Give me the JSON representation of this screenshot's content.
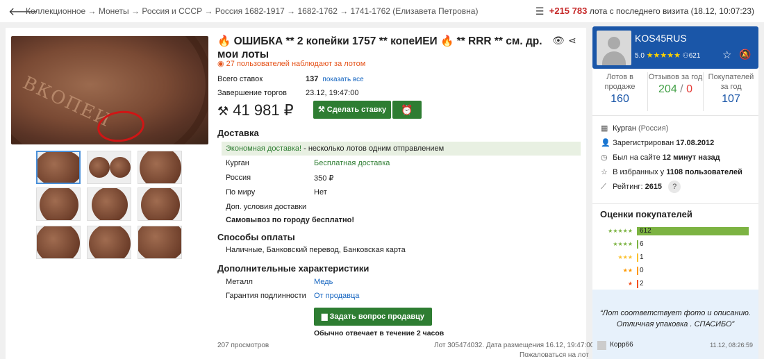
{
  "breadcrumbs": "Коллекционное → Монеты → Россия и СССР → Россия 1682-1917 → 1682-1762 → 1741-1762 (Елизавета Петровна)",
  "visit": {
    "count": "+215 783",
    "text": "лота с последнего визита (18.12, 10:07:23)"
  },
  "lot": {
    "title": "ОШИБКА ** 2 копейки 1757 ** копеИЕИ",
    "title_tail": "** RRR ** см. др. мои лоты",
    "watchers": "27 пользователей наблюдают за лотом",
    "bids_label": "Всего ставок",
    "bids_value": "137",
    "bids_link": "показать все",
    "end_label": "Завершение торгов",
    "end_value": "23.12, 19:47:00",
    "price": "41 981 ₽",
    "bid_button": "Сделать ставку"
  },
  "delivery": {
    "heading": "Доставка",
    "econ_link": "Экономная доставка!",
    "econ_text": " - несколько лотов одним отправлением",
    "rows": [
      {
        "label": "Курган",
        "value": "Бесплатная доставка"
      },
      {
        "label": "Россия",
        "value": "350 ₽"
      },
      {
        "label": "По миру",
        "value": "Нет"
      },
      {
        "label": "Доп. условия доставки",
        "value": ""
      }
    ],
    "pickup": "Самовывоз по городу бесплатно!"
  },
  "payment": {
    "heading": "Способы оплаты",
    "methods": "Наличные, Банковский перевод, Банковская карта"
  },
  "extra": {
    "heading": "Дополнительные характеристики",
    "rows": [
      {
        "label": "Металл",
        "value": "Медь"
      },
      {
        "label": "Гарантия подлинности",
        "value": "От продавца"
      }
    ]
  },
  "ask": {
    "button": "Задать вопрос продавцу",
    "note": "Обычно отвечает в течение 2 часов"
  },
  "footer": {
    "views": "207 просмотров",
    "lot_info": "Лот 305474032. Дата размещения 16.12, 19:47:00",
    "complain": "Пожаловаться на лот"
  },
  "seller": {
    "name": "KOS45RUS",
    "rating_score": "5.0",
    "followers": "621",
    "stats": [
      {
        "label": "Лотов в продаже",
        "value": "160"
      },
      {
        "label": "Отзывов за год",
        "value_pos": "204",
        "slash": " / ",
        "value_neg": "0"
      },
      {
        "label": "Покупателей за год",
        "value": "107"
      }
    ],
    "city": "Курган",
    "country": "(Россия)",
    "registered_prefix": "Зарегистрирован",
    "registered_date": "17.08.2012",
    "last_seen_prefix": "Был на сайте",
    "last_seen_value": "12 минут назад",
    "favorites_prefix": "В избранных у",
    "favorites_value": "1108 пользователей",
    "rating_prefix": "Рейтинг:",
    "rating_value": "2615",
    "rating_help": "?"
  },
  "ratings": {
    "title": "Оценки покупателей",
    "rows": [
      {
        "stars": "★★★★★",
        "count": "612",
        "share": 1.0,
        "color": "#7cb342"
      },
      {
        "stars": "★★★★",
        "count": "6",
        "share": 0.01,
        "color": "#7cb342"
      },
      {
        "stars": "★★★",
        "count": "1",
        "share": 0.002,
        "color": "#fbc02d"
      },
      {
        "stars": "★★",
        "count": "0",
        "share": 0,
        "color": "#ff9800"
      },
      {
        "stars": "★",
        "count": "2",
        "share": 0.003,
        "color": "#f4511e"
      }
    ]
  },
  "review": {
    "text": "“Лот соответствует фото и описанию. Отличная упаковка . СПАСИБО”",
    "user": "Корр66",
    "date": "11.12, 08:26:59"
  }
}
